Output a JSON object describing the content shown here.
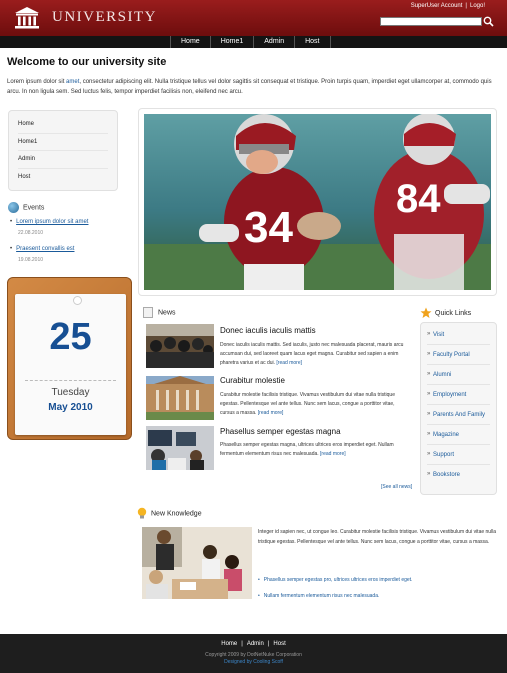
{
  "header": {
    "logo_text": "UNIVERSITY",
    "logo_icon": "university-building-icon",
    "top_links": [
      "SuperUser Account",
      "Logo!"
    ],
    "search_placeholder": "",
    "search_icon": "search-icon"
  },
  "nav": {
    "items": [
      "Home",
      "Home1",
      "Admin",
      "Host"
    ]
  },
  "main": {
    "title": "Welcome to our university site",
    "intro_before_link": "Lorem ipsum dolor sit ",
    "intro_link": "amet",
    "intro_after_link": ", consectetur adipiscing elit. Nulla tristique tellus vel dolor sagittis sit consequat et tristique. Proin turpis quam, imperdiet eget ullamcorper at, commodo quis arcu. In non ligula sem. Sed luctus felis, tempor imperdiet facilisis non, eleifend nec arcu."
  },
  "sidebar": {
    "menu": [
      "Home",
      "Home1",
      "Admin",
      "Host"
    ],
    "events_title": "Events",
    "events": [
      {
        "title": "Lorem ipsum dolor sit amet",
        "date": "22.08.2010"
      },
      {
        "title": "Praesent convallis est",
        "date": "19.08.2010"
      }
    ]
  },
  "calendar": {
    "day": "25",
    "weekday": "Tuesday",
    "month_year": "May 2010"
  },
  "news": {
    "title": "News",
    "items": [
      {
        "title": "Donec iaculis iaculis mattis",
        "body": "Donec iaculis iaculis mattis. Sed iaculis, justo nec malesuada placerat, mauris arcu accumsan dui, sed laoreet quam lacus eget magna. Curabitur sed sapien a enim pharetra varius et ac dui.",
        "more": "[read more]"
      },
      {
        "title": "Curabitur molestie",
        "body": "Curabitur molestie facilisis tristique. Vivamus vestibulum dui vitae nulla tristique egestas. Pellentesque vel ante tellus. Nunc sem lacus, congue a porttitor vitae, cursus a massa.",
        "more": "[read more]"
      },
      {
        "title": "Phasellus semper egestas magna",
        "body": "Phasellus semper egestas magna, ultrices ultrices eros imperdiet eget. Nullam fermentum elementum risus nec malesuada.",
        "more": "[read more]"
      }
    ],
    "see_all": "[See all news]"
  },
  "quick_links": {
    "title": "Quick Links",
    "items": [
      "Visit",
      "Faculty Portal",
      "Alumni",
      "Employment",
      "Parents And Family",
      "Magazine",
      "Support",
      "Bookstore"
    ]
  },
  "knowledge": {
    "title": "New Knowledge",
    "body": "Integer id sapien nec, ut congue leo. Curabitur molestie facilisis tristique. Vivamus vestibulum dui vitae nulla tristique egestas. Pellentesque vel ante tellus. Nunc sem lacus, congue a porttitor vitae, cursus a massa.",
    "bullets": [
      "Phasellus semper egestas pro, ultrices ultrices eros imperdiet eget.",
      "Nullam fermentum elementum risus nec malesuada."
    ]
  },
  "footer": {
    "links": [
      "Home",
      "Admin",
      "Host"
    ],
    "copyright": "Copyright 2009 by DotNetNuke Corporation",
    "designer": "Designed by Cooling Scoff"
  },
  "colors": {
    "header_red": "#8a1717",
    "nav_bg": "#141414",
    "link_blue": "#1a5a9a",
    "calendar_blue": "#174f93",
    "footer_bg": "#1e1e1e"
  }
}
